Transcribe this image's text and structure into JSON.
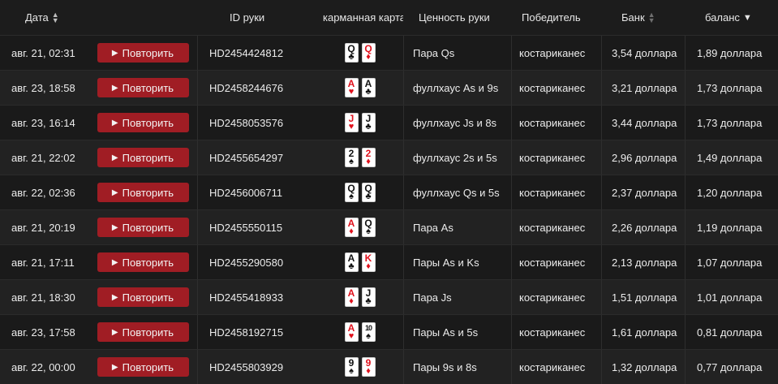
{
  "columns": {
    "date": "Дата",
    "hand_id": "ID руки",
    "pocket_cards": "карманная карта",
    "hand_value": "Ценность руки",
    "winner": "Победитель",
    "pot": "Банк",
    "balance": "баланс"
  },
  "replay_label": "Повторить",
  "colors": {
    "replay": "#a01d24",
    "red_suit": "#e0121d",
    "black_suit": "#111111"
  },
  "rows": [
    {
      "date": "авг. 21, 02:31",
      "id": "HD2454424812",
      "cards": [
        {
          "rank": "Q",
          "suit": "♣",
          "color": "black"
        },
        {
          "rank": "Q",
          "suit": "♦",
          "color": "red"
        }
      ],
      "value": "Пара Qs",
      "winner": "костариканес",
      "pot": "3,54 доллара",
      "balance": "1,89 доллара"
    },
    {
      "date": "авг. 23, 18:58",
      "id": "HD2458244676",
      "cards": [
        {
          "rank": "A",
          "suit": "♥",
          "color": "red"
        },
        {
          "rank": "A",
          "suit": "♣",
          "color": "black"
        }
      ],
      "value": "фуллхаус As и 9s",
      "winner": "костариканес",
      "pot": "3,21 доллара",
      "balance": "1,73 доллара"
    },
    {
      "date": "авг. 23, 16:14",
      "id": "HD2458053576",
      "cards": [
        {
          "rank": "J",
          "suit": "♥",
          "color": "red"
        },
        {
          "rank": "J",
          "suit": "♣",
          "color": "black"
        }
      ],
      "value": "фуллхаус Js и 8s",
      "winner": "костариканес",
      "pot": "3,44 доллара",
      "balance": "1,73 доллара"
    },
    {
      "date": "авг. 21, 22:02",
      "id": "HD2455654297",
      "cards": [
        {
          "rank": "2",
          "suit": "♠",
          "color": "black"
        },
        {
          "rank": "2",
          "suit": "♦",
          "color": "red"
        }
      ],
      "value": "фуллхаус 2s и 5s",
      "winner": "костариканес",
      "pot": "2,96 доллара",
      "balance": "1,49 доллара"
    },
    {
      "date": "авг. 22, 02:36",
      "id": "HD2456006711",
      "cards": [
        {
          "rank": "Q",
          "suit": "♠",
          "color": "black"
        },
        {
          "rank": "Q",
          "suit": "♣",
          "color": "black"
        }
      ],
      "value": "фуллхаус Qs и 5s",
      "winner": "костариканес",
      "pot": "2,37 доллара",
      "balance": "1,20 доллара"
    },
    {
      "date": "авг. 21, 20:19",
      "id": "HD2455550115",
      "cards": [
        {
          "rank": "A",
          "suit": "♦",
          "color": "red"
        },
        {
          "rank": "Q",
          "suit": "♠",
          "color": "black"
        }
      ],
      "value": "Пара As",
      "winner": "костариканес",
      "pot": "2,26 доллара",
      "balance": "1,19 доллара"
    },
    {
      "date": "авг. 21, 17:11",
      "id": "HD2455290580",
      "cards": [
        {
          "rank": "A",
          "suit": "♣",
          "color": "black"
        },
        {
          "rank": "K",
          "suit": "♦",
          "color": "red"
        }
      ],
      "value": "Пары As и Ks",
      "winner": "костариканес",
      "pot": "2,13 доллара",
      "balance": "1,07 доллара"
    },
    {
      "date": "авг. 21, 18:30",
      "id": "HD2455418933",
      "cards": [
        {
          "rank": "A",
          "suit": "♦",
          "color": "red"
        },
        {
          "rank": "J",
          "suit": "♣",
          "color": "black"
        }
      ],
      "value": "Пара Js",
      "winner": "костариканес",
      "pot": "1,51 доллара",
      "balance": "1,01 доллара"
    },
    {
      "date": "авг. 23, 17:58",
      "id": "HD2458192715",
      "cards": [
        {
          "rank": "A",
          "suit": "♥",
          "color": "red"
        },
        {
          "rank": "10",
          "suit": "♠",
          "color": "black"
        }
      ],
      "value": "Пары As и 5s",
      "winner": "костариканес",
      "pot": "1,61 доллара",
      "balance": "0,81 доллара"
    },
    {
      "date": "авг. 22, 00:00",
      "id": "HD2455803929",
      "cards": [
        {
          "rank": "9",
          "suit": "♠",
          "color": "black"
        },
        {
          "rank": "9",
          "suit": "♦",
          "color": "red"
        }
      ],
      "value": "Пары 9s и 8s",
      "winner": "костариканес",
      "pot": "1,32 доллара",
      "balance": "0,77 доллара"
    }
  ]
}
